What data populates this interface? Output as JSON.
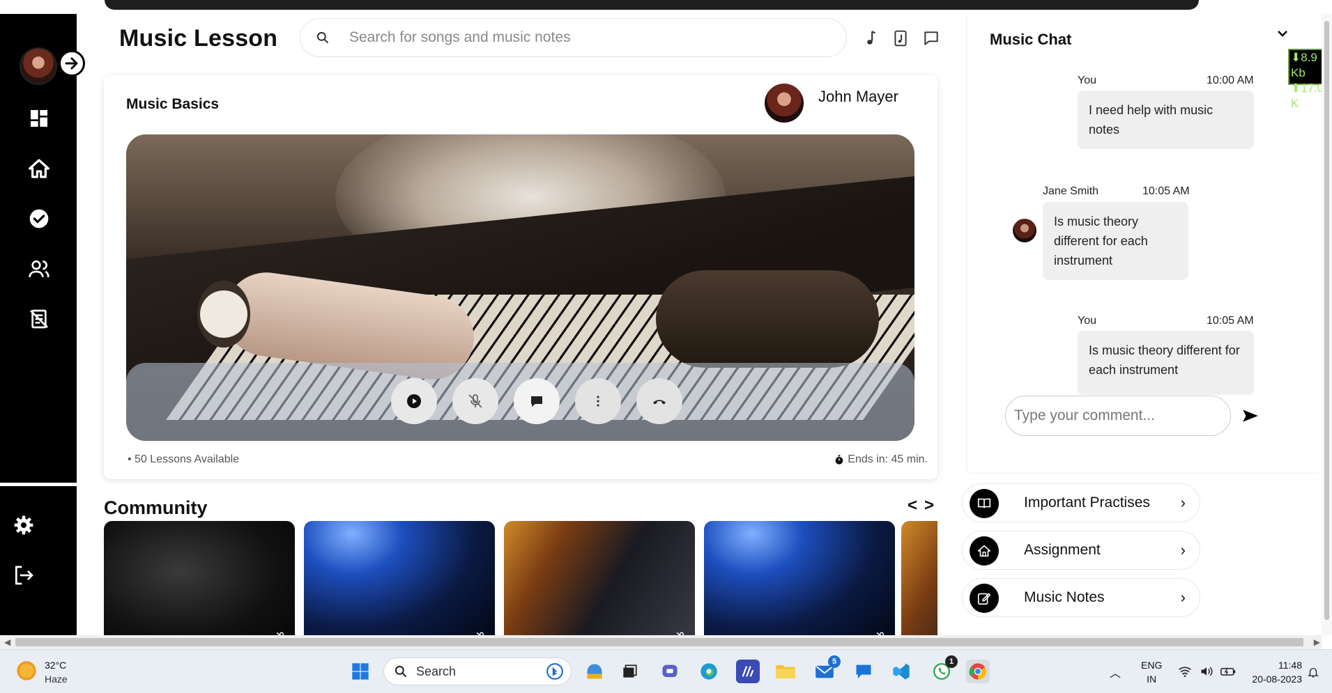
{
  "header": {
    "title": "Music Lesson",
    "search_placeholder": "Search for songs and music notes",
    "icons": [
      "music-note-icon",
      "music-file-icon",
      "chat-icon"
    ]
  },
  "sidebar": {
    "items": [
      "dashboard-icon",
      "home-icon",
      "check-circle-icon",
      "users-icon",
      "notes-off-icon"
    ],
    "bottom_items": [
      "settings-icon",
      "logout-icon"
    ]
  },
  "lesson": {
    "title": "Music Basics",
    "teacher": "John Mayer",
    "lessons_available": "50 Lessons Available",
    "ends_in": "Ends in: 45 min.",
    "controls": [
      "play-icon",
      "mic-off-icon",
      "chat-bubble-icon",
      "more-icon",
      "hang-up-icon"
    ]
  },
  "community": {
    "title": "Community",
    "prev": "<",
    "next": ">"
  },
  "chat": {
    "title": "Music Chat",
    "messages": [
      {
        "author": "You",
        "time": "10:00 AM",
        "text": "I need help with music notes"
      },
      {
        "author": "Jane Smith",
        "time": "10:05 AM",
        "text": "Is music theory different for each instrument"
      },
      {
        "author": "You",
        "time": "10:05 AM",
        "text": "Is music theory different for each instrument"
      }
    ],
    "input_placeholder": "Type your comment..."
  },
  "quick_links": [
    {
      "label": "Important Practises",
      "icon": "book-icon"
    },
    {
      "label": "Assignment",
      "icon": "home-icon"
    },
    {
      "label": "Music Notes",
      "icon": "edit-icon"
    }
  ],
  "speed": {
    "down": "8.9 Kb",
    "up": "17.0 K"
  },
  "taskbar": {
    "weather_temp": "32°C",
    "weather_desc": "Haze",
    "search_label": "Search",
    "lang_top": "ENG",
    "lang_bottom": "IN",
    "time": "11:48",
    "date": "20-08-2023",
    "mail_badge": "5",
    "whatsapp_badge": "1"
  },
  "colors": {
    "sidebar": "#000000",
    "accent": "#000000",
    "bubble": "#efefef",
    "taskbar": "#e9eef4"
  }
}
